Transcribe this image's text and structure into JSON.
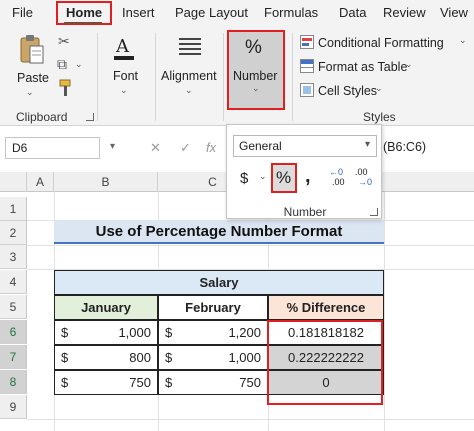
{
  "tabs": [
    "File",
    "Home",
    "Insert",
    "Page Layout",
    "Formulas",
    "Data",
    "Review",
    "View"
  ],
  "ribbon": {
    "clipboard": {
      "paste": "Paste",
      "label": "Clipboard"
    },
    "font": {
      "label": "Font"
    },
    "alignment": {
      "label": "Alignment"
    },
    "number": {
      "label": "Number",
      "icon_glyph": "%"
    },
    "styles": {
      "conditional_formatting": "Conditional Formatting",
      "format_as_table": "Format as Table",
      "cell_styles": "Cell Styles",
      "label": "Styles"
    }
  },
  "formula_bar": {
    "name_box": "D6",
    "formula": "(B6:C6)"
  },
  "columns": [
    "A",
    "B",
    "C"
  ],
  "rows": [
    "1",
    "2",
    "3",
    "4",
    "5",
    "6",
    "7",
    "8",
    "9"
  ],
  "number_popup": {
    "format": "General",
    "currency": "$",
    "percent": "%",
    "comma": ",",
    "increase_decimal": ".00",
    "decrease_decimal": ".00",
    "label": "Number"
  },
  "sheet": {
    "title": "Use of Percentage Number Format",
    "table_header": "Salary",
    "col_headers": [
      "January",
      "February",
      "% Difference"
    ],
    "rows": [
      {
        "jan_symbol": "$",
        "jan": "1,000",
        "feb_symbol": "$",
        "feb": "1,200",
        "diff": "0.181818182"
      },
      {
        "jan_symbol": "$",
        "jan": "800",
        "feb_symbol": "$",
        "feb": "1,000",
        "diff": "0.222222222"
      },
      {
        "jan_symbol": "$",
        "jan": "750",
        "feb_symbol": "$",
        "feb": "750",
        "diff": "0"
      }
    ]
  },
  "colors": {
    "accent_red": "#e02020",
    "excel_green": "#217346",
    "header_green": "#e2efda",
    "header_peach": "#fce4d6",
    "title_blue": "#dce6f2"
  }
}
